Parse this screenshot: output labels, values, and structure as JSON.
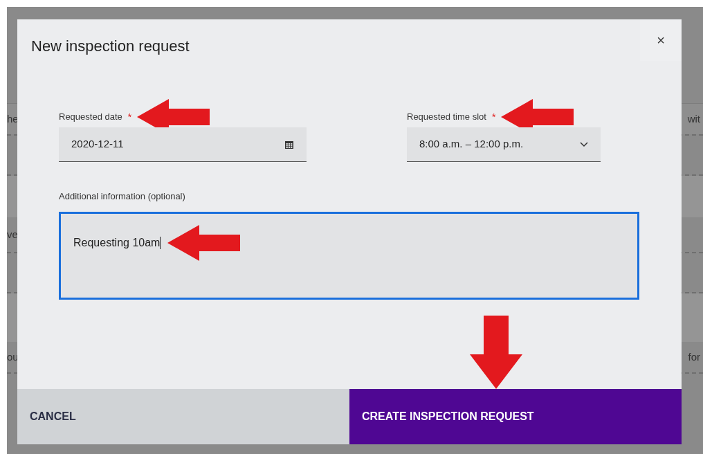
{
  "background": {
    "rows": [
      {
        "left": "he",
        "right": "wit"
      },
      {
        "left": "ve",
        "right": ""
      },
      {
        "left": "ou",
        "right": "for"
      }
    ]
  },
  "dialog": {
    "title": "New inspection request",
    "close": "×",
    "fields": [
      {
        "kind": "date",
        "label": "Requested date",
        "required_mark": "*",
        "value": "2020-12-11",
        "annotated": true
      },
      {
        "kind": "select",
        "label": "Requested time slot",
        "required_mark": "*",
        "value": "8:00 a.m. – 12:00 p.m.",
        "annotated": true
      }
    ],
    "textarea": {
      "label": "Additional information (optional)",
      "value": "Requesting 10am",
      "focused": true,
      "annotated": true
    },
    "buttons": [
      {
        "label": "CANCEL",
        "kind": "secondary",
        "annotated": false
      },
      {
        "label": "CREATE INSPECTION REQUEST",
        "kind": "primary",
        "annotated": true
      }
    ]
  }
}
